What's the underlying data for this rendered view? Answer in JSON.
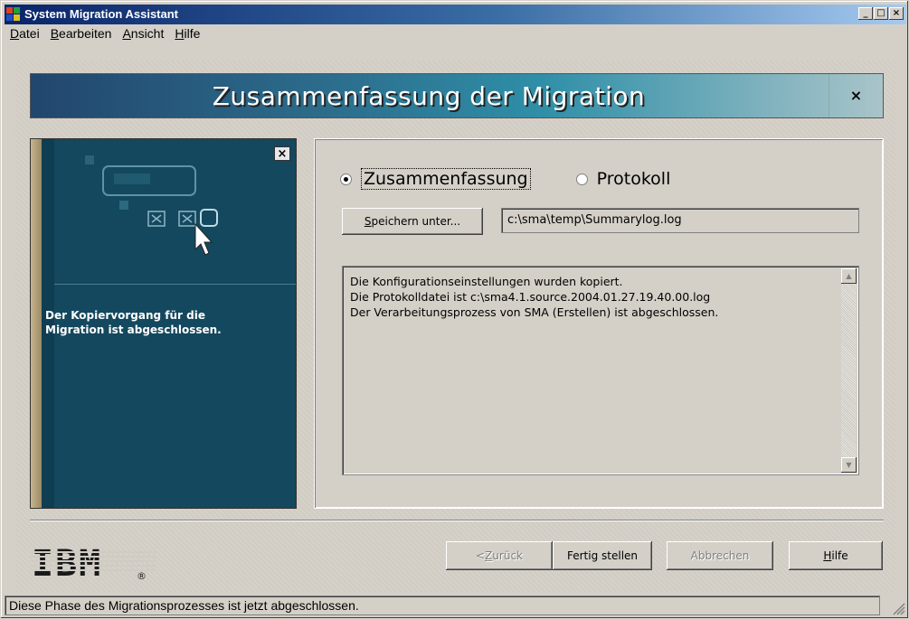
{
  "window": {
    "title": "System Migration Assistant",
    "buttons": {
      "minimize": "_",
      "maximize": "□",
      "close": "×"
    }
  },
  "menu": {
    "items": [
      {
        "key": "D",
        "rest": "atei"
      },
      {
        "key": "B",
        "rest": "earbeiten"
      },
      {
        "key": "A",
        "rest": "nsicht"
      },
      {
        "key": "H",
        "rest": "ilfe"
      }
    ]
  },
  "banner": {
    "title": "Zusammenfassung der Migration",
    "close": "×"
  },
  "left_panel": {
    "close": "×",
    "message_line1": "Der Kopiervorgang für die",
    "message_line2": "Migration ist abgeschlossen."
  },
  "options": {
    "summary_label": "Zusammenfassung",
    "log_label": "Protokoll",
    "selected": "summary"
  },
  "save": {
    "button_key": "S",
    "button_rest": "peichern unter...",
    "path": "c:\\sma\\temp\\Summarylog.log"
  },
  "log": {
    "lines": [
      "Die Konfigurationseinstellungen wurden kopiert.",
      "Die Protokolldatei ist  c:\\sma4.1.source.2004.01.27.19.40.00.log",
      "Der Verarbeitungsprozess von SMA (Erstellen) ist abgeschlossen."
    ]
  },
  "nav": {
    "back_prefix": "< ",
    "back_key": "Z",
    "back_rest": "urück",
    "finish": "Fertig stellen",
    "cancel": "Abbrechen",
    "help_key": "H",
    "help_rest": "ilfe"
  },
  "brand": {
    "logo_text": "IBM",
    "registered": "®"
  },
  "status": {
    "text": "Diese Phase des Migrationsprozesses ist jetzt abgeschlossen."
  },
  "colors": {
    "title_start": "#0a246a",
    "title_end": "#a6caf0",
    "left_panel": "#14485e",
    "face": "#d4d0c8"
  },
  "icons": [
    "app-icon",
    "minimize-icon",
    "maximize-icon",
    "close-icon",
    "cursor-arrow-icon",
    "scroll-up-icon",
    "scroll-down-icon",
    "size-grip-icon"
  ]
}
